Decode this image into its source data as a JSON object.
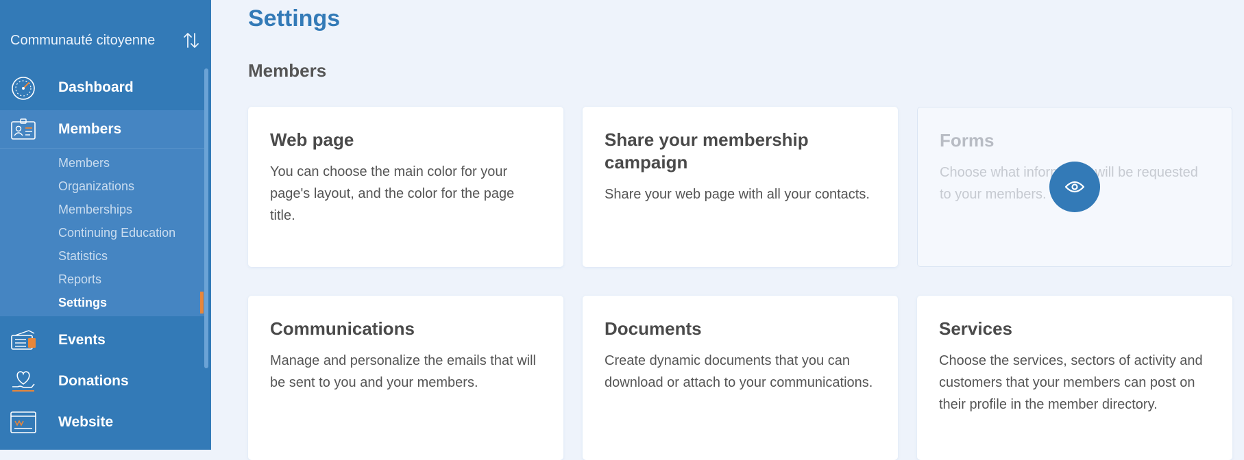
{
  "sidebar": {
    "org_name": "Communauté citoyenne",
    "nav": {
      "dashboard": "Dashboard",
      "members": "Members",
      "events": "Events",
      "donations": "Donations",
      "website": "Website"
    },
    "submenu": [
      "Members",
      "Organizations",
      "Memberships",
      "Continuing Education",
      "Statistics",
      "Reports",
      "Settings"
    ],
    "active_submenu": "Settings"
  },
  "main": {
    "page_title": "Settings",
    "section_title": "Members",
    "cards": [
      {
        "title": "Web page",
        "description": "You can choose the main color for your page's layout, and the color for the page title."
      },
      {
        "title": "Share your membership campaign",
        "description": "Share your web page with all your contacts."
      },
      {
        "title": "Forms",
        "description": "Choose what information will be requested to your members."
      },
      {
        "title": "Communications",
        "description": "Manage and personalize the emails that will be sent to you and your members."
      },
      {
        "title": "Documents",
        "description": "Create dynamic documents that you can download or attach to your communications."
      },
      {
        "title": "Services",
        "description": "Choose the services, sectors of activity and customers that your members can post on their profile in the member directory."
      }
    ]
  },
  "colors": {
    "sidebar": "#337ab7",
    "sidebar_active": "#4585c2",
    "accent": "#e8863a",
    "page_background": "#eef3fb"
  },
  "icons": [
    "switch-arrows-icon",
    "dashboard-gauge-icon",
    "members-badge-icon",
    "events-ticket-icon",
    "donations-heart-hand-icon",
    "website-browser-icon",
    "eye-icon"
  ]
}
